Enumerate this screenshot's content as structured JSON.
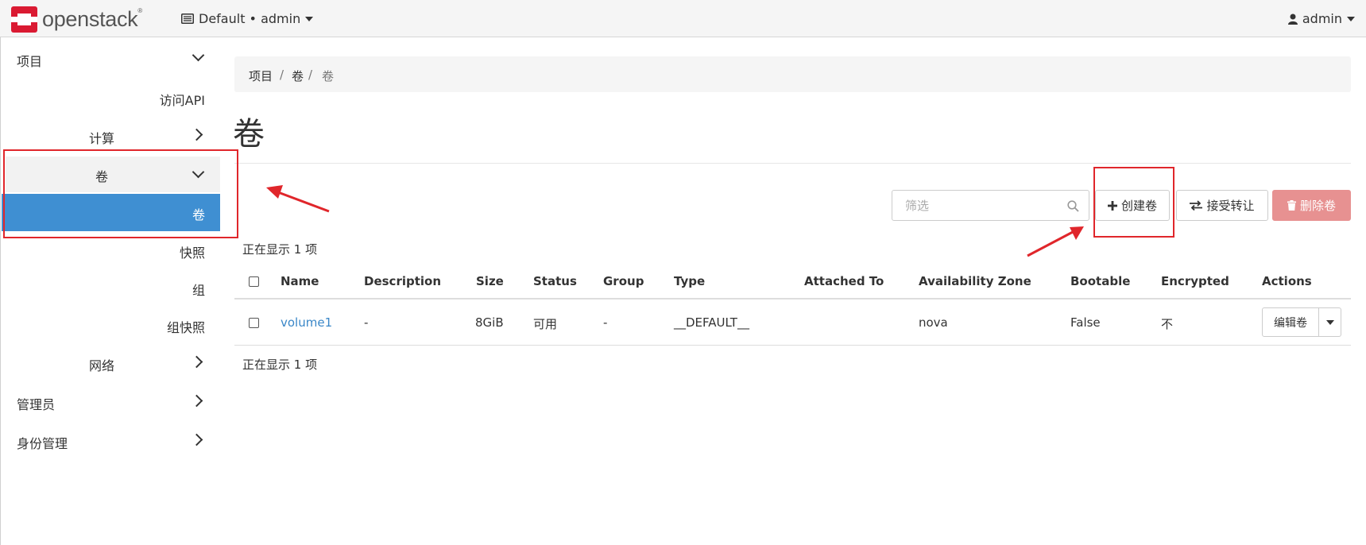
{
  "header": {
    "brand": "openstack",
    "brand_mark": "®",
    "project_switcher": "Default • admin",
    "user": "admin",
    "brand_color": "#da1a32"
  },
  "sidebar": {
    "project": "项目",
    "access_api": "访问API",
    "compute": "计算",
    "volumes_group": "卷",
    "volumes": "卷",
    "snapshots": "快照",
    "groups": "组",
    "group_snapshots": "组快照",
    "network": "网络",
    "admin": "管理员",
    "identity": "身份管理",
    "active_color": "#3f8fd2"
  },
  "breadcrumb": [
    "项目",
    "卷",
    "卷"
  ],
  "page_title": "卷",
  "toolbar": {
    "filter_placeholder": "筛选",
    "create_label": "创建卷",
    "accept_transfer_label": "接受转让",
    "delete_label": "删除卷"
  },
  "table": {
    "count_text": "正在显示 1 项",
    "columns": [
      "Name",
      "Description",
      "Size",
      "Status",
      "Group",
      "Type",
      "Attached To",
      "Availability Zone",
      "Bootable",
      "Encrypted",
      "Actions"
    ],
    "rows": [
      {
        "name": "volume1",
        "description": "-",
        "size": "8GiB",
        "status": "可用",
        "group": "-",
        "type": "__DEFAULT__",
        "attached_to": "",
        "availability_zone": "nova",
        "bootable": "False",
        "encrypted": "不",
        "action": "编辑卷"
      }
    ]
  }
}
